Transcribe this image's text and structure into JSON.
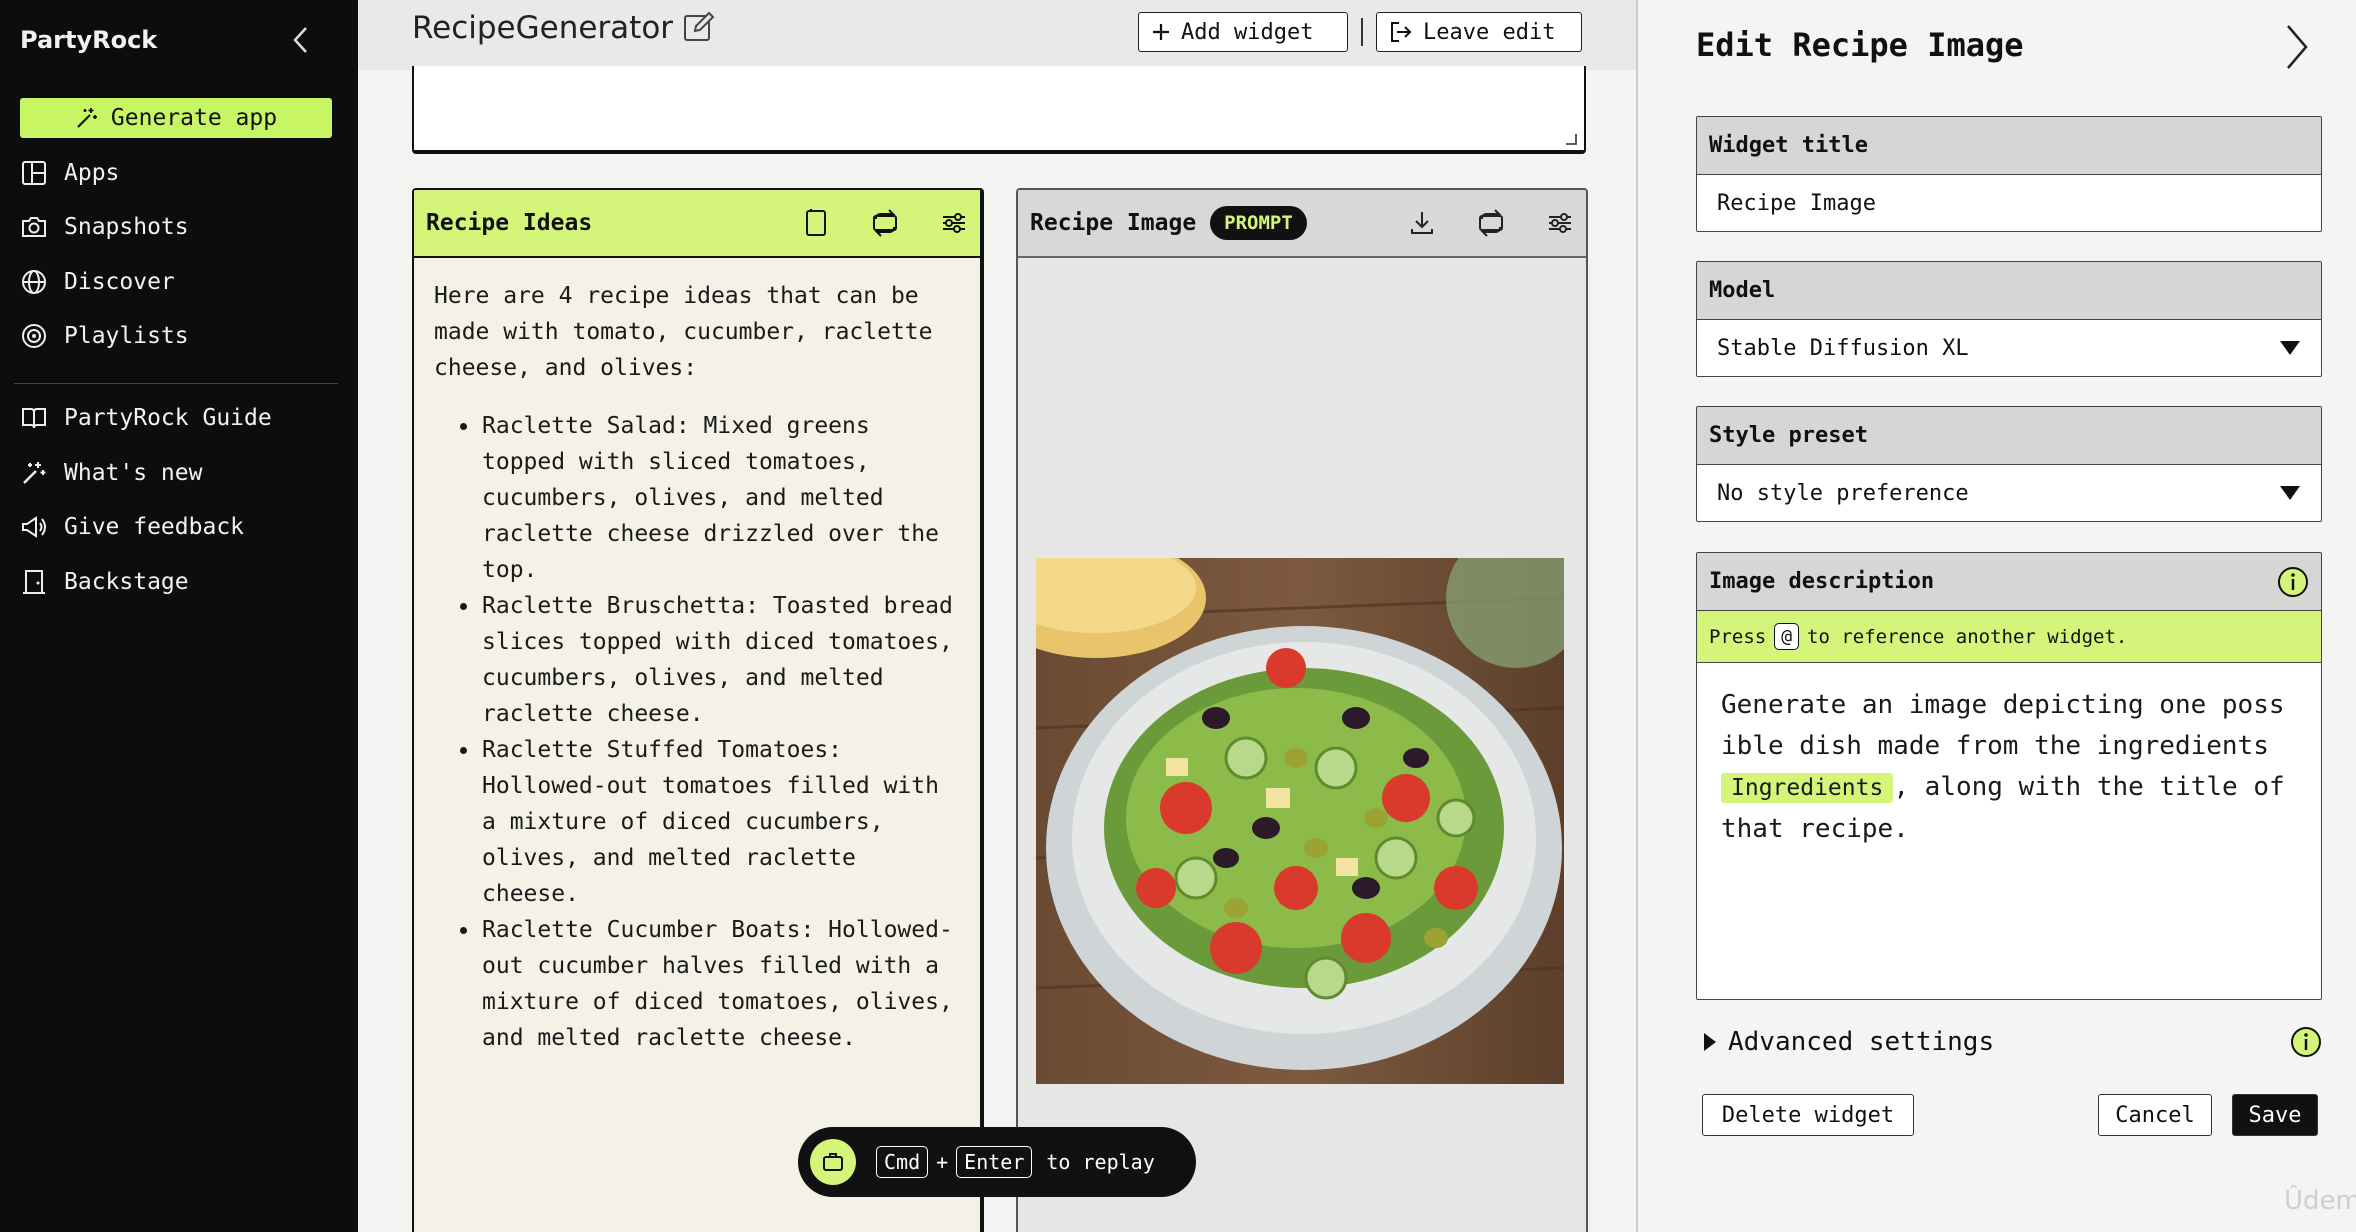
{
  "sidebar": {
    "brand": "PartyRock",
    "generate_label": "Generate app",
    "items": [
      {
        "label": "Apps",
        "icon": "apps-icon"
      },
      {
        "label": "Snapshots",
        "icon": "camera-icon"
      },
      {
        "label": "Discover",
        "icon": "globe-icon"
      },
      {
        "label": "Playlists",
        "icon": "playlist-icon"
      },
      {
        "label": "PartyRock Guide",
        "icon": "book-icon"
      },
      {
        "label": "What's new",
        "icon": "sparkle-icon"
      },
      {
        "label": "Give feedback",
        "icon": "megaphone-icon"
      },
      {
        "label": "Backstage",
        "icon": "backstage-icon"
      }
    ]
  },
  "header": {
    "app_title": "RecipeGenerator",
    "add_widget": "Add widget",
    "leave_edit": "Leave edit"
  },
  "ideas": {
    "title": "Recipe Ideas",
    "intro": "Here are 4 recipe ideas that can be made with tomato, cucumber, raclette cheese, and olives:",
    "list": [
      "Raclette Salad: Mixed greens topped with sliced tomatoes, cucumbers, olives, and melted raclette cheese drizzled over the top.",
      "Raclette Bruschetta: Toasted bread slices topped with diced tomatoes, cucumbers, olives, and melted raclette cheese.",
      "Raclette Stuffed Tomatoes: Hollowed-out tomatoes filled with a mixture of diced cucumbers, olives, and melted raclette cheese.",
      "Raclette Cucumber Boats: Hollowed-out cucumber halves filled with a mixture of diced tomatoes, olives, and melted raclette cheese."
    ]
  },
  "image_widget": {
    "title": "Recipe Image",
    "badge": "PROMPT"
  },
  "replay": {
    "key1": "Cmd",
    "plus": "+",
    "key2": "Enter",
    "suffix": "to replay"
  },
  "panel": {
    "title": "Edit Recipe Image",
    "widget_title_label": "Widget title",
    "widget_title_value": "Recipe Image",
    "model_label": "Model",
    "model_value": "Stable Diffusion XL",
    "style_label": "Style preset",
    "style_value": "No style preference",
    "desc_label": "Image description",
    "hint_press": "Press",
    "hint_key": "@",
    "hint_rest": "to reference another widget.",
    "desc_before": "Generate an image depicting one possible dish made from the ingredients ",
    "desc_chip": "Ingredients",
    "desc_after": ", along with the title of that recipe.",
    "advanced": "Advanced settings",
    "delete": "Delete widget",
    "cancel": "Cancel",
    "save": "Save"
  },
  "watermark": "Ûdemy",
  "colors": {
    "accent": "#d5f57a",
    "sidebar_bg": "#0d0d0d",
    "generate": "#c8f563"
  }
}
